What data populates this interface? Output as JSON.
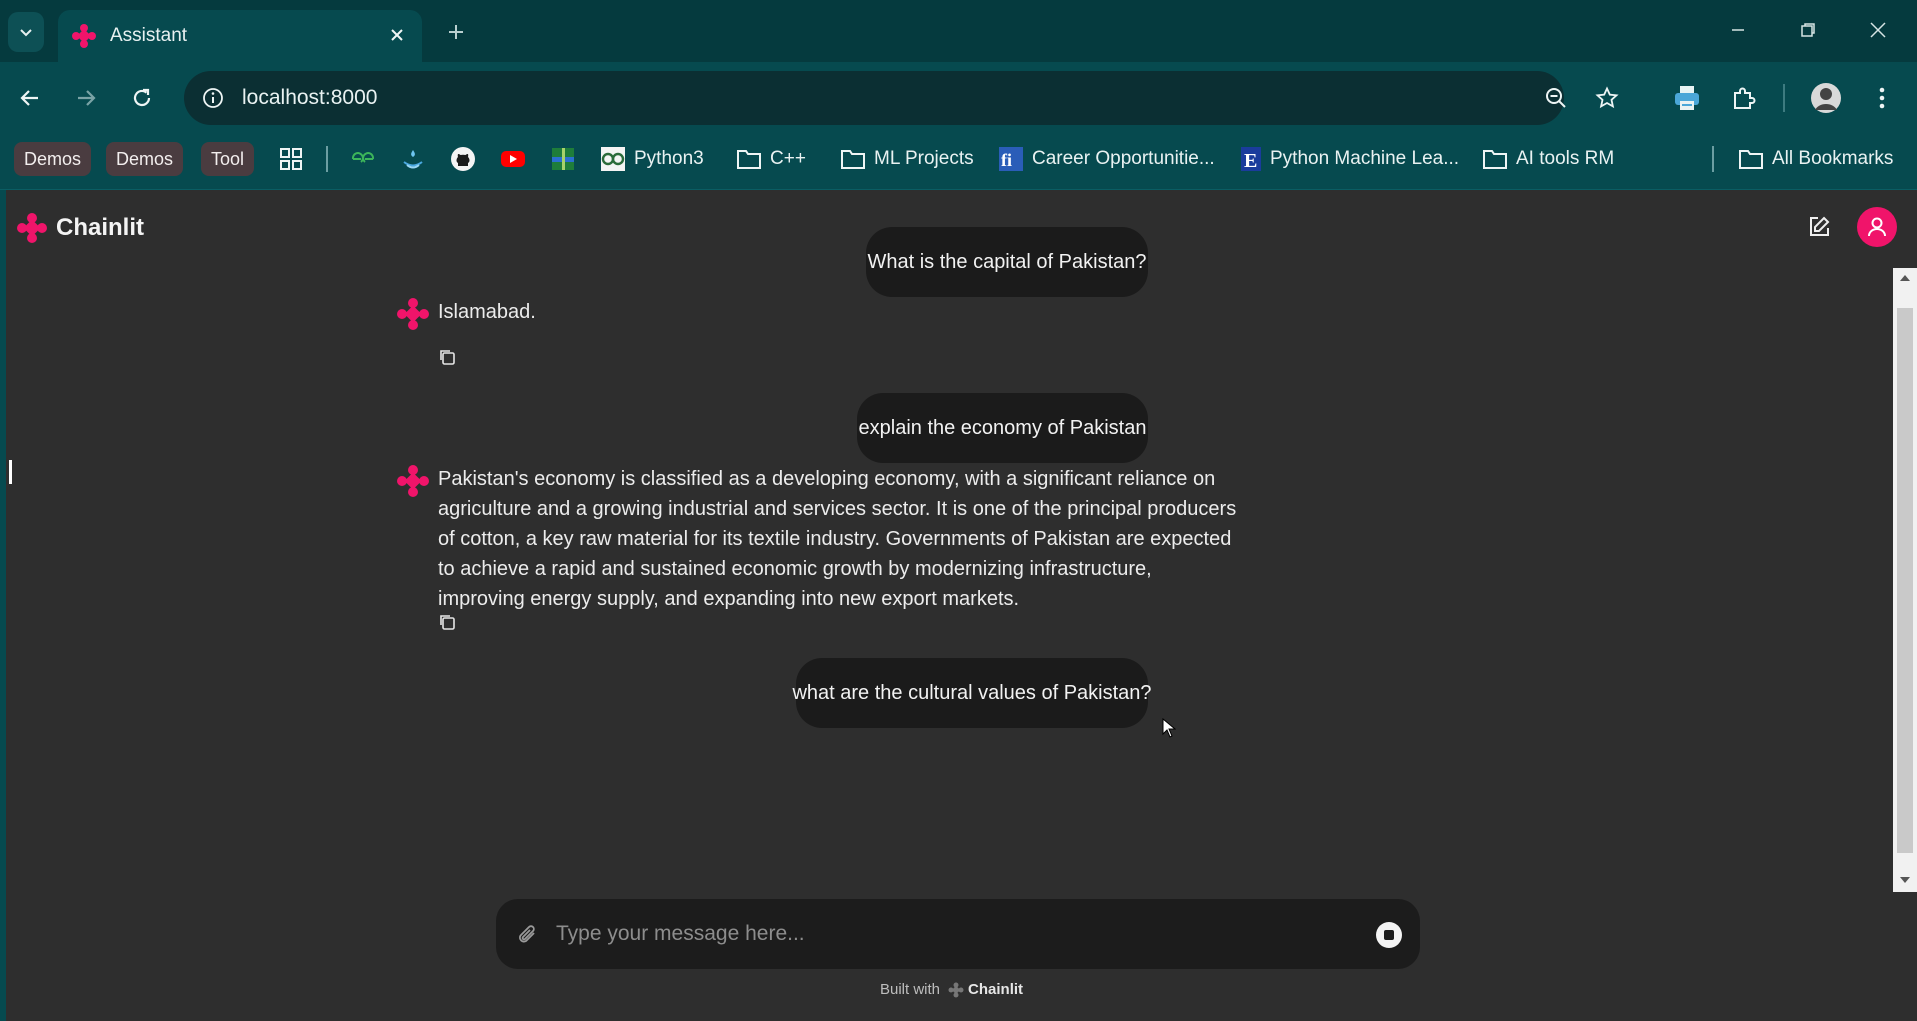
{
  "browser": {
    "tab_title": "Assistant",
    "url": "localhost:8000",
    "bookmarks": {
      "chips": [
        "Demos",
        "Demos",
        "Tool"
      ],
      "items": [
        "Python3",
        "C++",
        "ML Projects",
        "Career Opportunitie...",
        "Python Machine Lea...",
        "AI tools RM"
      ],
      "all_bookmarks": "All Bookmarks"
    }
  },
  "app": {
    "brand": "Chainlit",
    "messages": {
      "user_1": "What is the capital of Pakistan?",
      "bot_1": "Islamabad.",
      "user_2": "explain the economy of Pakistan",
      "bot_2_lines": [
        "Pakistan's economy is classified as a developing economy, with a significant reliance on",
        "agriculture and a growing industrial and services sector. It is one of the principal producers",
        "of cotton, a key raw material for its textile industry. Governments of Pakistan are expected",
        "to achieve a rapid and sustained economic growth by modernizing infrastructure,",
        "improving energy supply, and expanding into new export markets."
      ],
      "user_3": "what are the cultural values of Pakistan?"
    },
    "composer": {
      "placeholder": "Type your message here..."
    },
    "footer": {
      "built_with": "Built with",
      "brand": "Chainlit"
    }
  },
  "colors": {
    "chrome_bg": "#064a4f",
    "app_bg": "#2e2e2e",
    "accent": "#f0146a"
  }
}
